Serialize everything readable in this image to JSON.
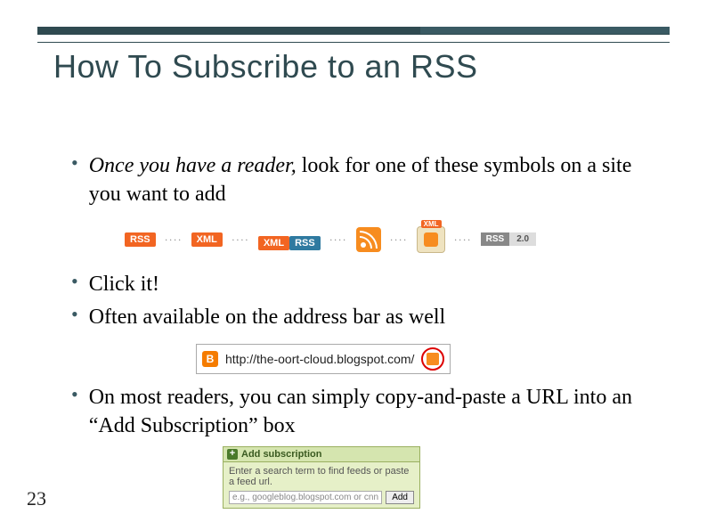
{
  "title": "How To Subscribe to an RSS",
  "bullets": {
    "b1a": "Once you have a reader,",
    "b1b": " look for one of these symbols on a site you want to add",
    "b2": "Click it!",
    "b3": "Often available on the address bar as well",
    "b4": "On most readers, you can simply copy-and-paste a URL into an “Add Subscription” box"
  },
  "badges": {
    "rss": "RSS",
    "xml": "XML",
    "xml2": "XML",
    "rss2": "RSS",
    "xml3": "XML",
    "grey_l": "RSS",
    "grey_r": "2.0"
  },
  "address_bar": {
    "url": "http://the-oort-cloud.blogspot.com/"
  },
  "add_sub": {
    "header": "Add subscription",
    "hint": "Enter a search term to find feeds or paste a feed url.",
    "placeholder": "e.g., googleblog.blogspot.com or cnn",
    "button": "Add"
  },
  "page_number": "23"
}
